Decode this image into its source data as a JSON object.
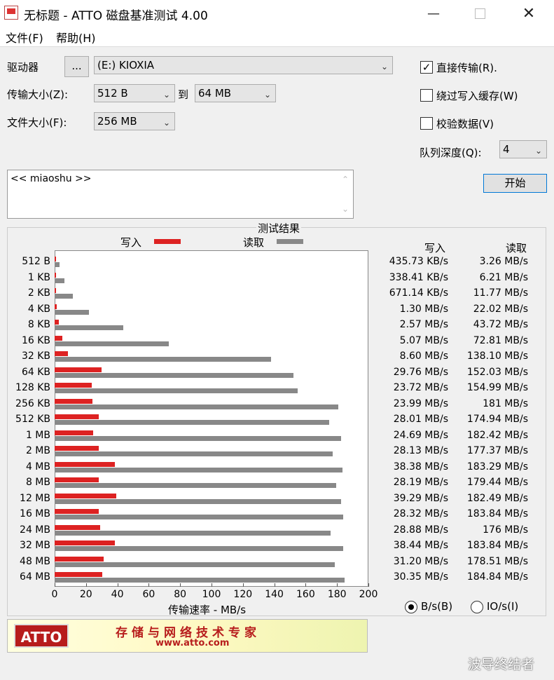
{
  "window": {
    "title": "无标题 - ATTO 磁盘基准测试 4.00"
  },
  "menu": {
    "file": "文件(F)",
    "help": "帮助(H)"
  },
  "settings": {
    "drive_label": "驱动器",
    "browse_label": "...",
    "drive_value": "(E:) KIOXIA",
    "transfer_size_label": "传输大小(Z):",
    "transfer_from": "512 B",
    "to_label": "到",
    "transfer_to": "64 MB",
    "file_size_label": "文件大小(F):",
    "file_size": "256 MB",
    "direct_io_label": "直接传输(R).",
    "direct_io_checked": true,
    "bypass_cache_label": "绕过写入缓存(W)",
    "verify_label": "校验数据(V)",
    "queue_depth_label": "队列深度(Q):",
    "queue_depth": "4",
    "start_label": "开始",
    "description": "<< miaoshu >>"
  },
  "results": {
    "title": "测试结果",
    "write_legend": "写入",
    "read_legend": "读取",
    "write_header": "写入",
    "read_header": "读取",
    "xlabel": "传输速率 - MB/s",
    "write_color": "#dd2222",
    "read_color": "#888888"
  },
  "chart_data": {
    "type": "bar",
    "orientation": "horizontal",
    "categories": [
      "512 B",
      "1 KB",
      "2 KB",
      "4 KB",
      "8 KB",
      "16 KB",
      "32 KB",
      "64 KB",
      "128 KB",
      "256 KB",
      "512 KB",
      "1 MB",
      "2 MB",
      "4 MB",
      "8 MB",
      "12 MB",
      "16 MB",
      "24 MB",
      "32 MB",
      "48 MB",
      "64 MB"
    ],
    "series": [
      {
        "name": "写入",
        "values": [
          0.43,
          0.34,
          0.67,
          1.3,
          2.57,
          5.07,
          8.6,
          29.76,
          23.72,
          23.99,
          28.01,
          24.69,
          28.13,
          38.38,
          28.19,
          39.29,
          28.32,
          28.88,
          38.44,
          31.2,
          30.35
        ]
      },
      {
        "name": "读取",
        "values": [
          3.26,
          6.21,
          11.77,
          22.02,
          43.72,
          72.81,
          138.1,
          152.03,
          154.99,
          181,
          174.94,
          182.42,
          177.37,
          183.29,
          179.44,
          182.49,
          183.84,
          176,
          183.84,
          178.51,
          184.84
        ]
      }
    ],
    "xlim": [
      0,
      200
    ],
    "xticks": [
      "0",
      "20",
      "40",
      "60",
      "80",
      "100",
      "120",
      "140",
      "160",
      "180",
      "200"
    ],
    "write_text": [
      "435.73 KB/s",
      "338.41 KB/s",
      "671.14 KB/s",
      "1.30 MB/s",
      "2.57 MB/s",
      "5.07 MB/s",
      "8.60 MB/s",
      "29.76 MB/s",
      "23.72 MB/s",
      "23.99 MB/s",
      "28.01 MB/s",
      "24.69 MB/s",
      "28.13 MB/s",
      "38.38 MB/s",
      "28.19 MB/s",
      "39.29 MB/s",
      "28.32 MB/s",
      "28.88 MB/s",
      "38.44 MB/s",
      "31.20 MB/s",
      "30.35 MB/s"
    ],
    "read_text": [
      "3.26 MB/s",
      "6.21 MB/s",
      "11.77 MB/s",
      "22.02 MB/s",
      "43.72 MB/s",
      "72.81 MB/s",
      "138.10 MB/s",
      "152.03 MB/s",
      "154.99 MB/s",
      "181 MB/s",
      "174.94 MB/s",
      "182.42 MB/s",
      "177.37 MB/s",
      "183.29 MB/s",
      "179.44 MB/s",
      "182.49 MB/s",
      "183.84 MB/s",
      "176 MB/s",
      "183.84 MB/s",
      "178.51 MB/s",
      "184.84 MB/s"
    ]
  },
  "units": {
    "bytes_label": "B/s(B)",
    "io_label": "IO/s(I)",
    "selected": "bytes"
  },
  "banner": {
    "logo_text": "ATTO",
    "slogan": "存储与网络技术专家",
    "url": "www.atto.com"
  },
  "watermark": "波导终结者"
}
